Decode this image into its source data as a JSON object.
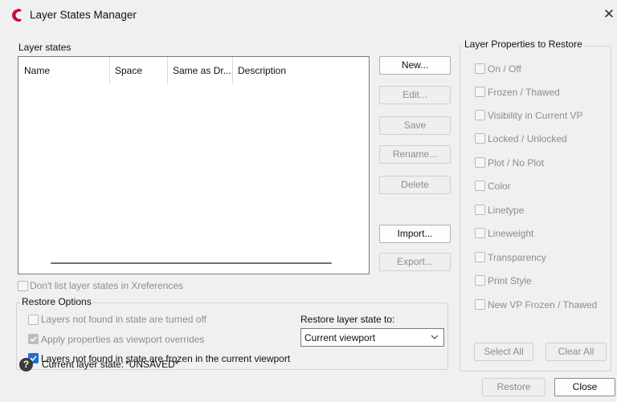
{
  "window": {
    "title": "Layer States Manager",
    "close_glyph": "✕"
  },
  "layer_states": {
    "label": "Layer states",
    "columns": [
      "Name",
      "Space",
      "Same as Dr...",
      "Description"
    ],
    "rows": []
  },
  "buttons": {
    "new": "New...",
    "edit": "Edit...",
    "save": "Save",
    "rename": "Rename...",
    "delete": "Delete",
    "import": "Import...",
    "export": "Export..."
  },
  "dont_list_xrefs": {
    "label": "Don't list layer states in Xreferences",
    "checked": false
  },
  "restore_options": {
    "legend": "Restore Options",
    "opt1": "Layers not found in state are turned off",
    "opt2": "Apply properties as viewport overrides",
    "opt3": "Layers not found in state are frozen in the current viewport",
    "restore_to_label": "Restore layer state to:",
    "restore_to_value": "Current viewport"
  },
  "properties": {
    "legend": "Layer Properties to Restore",
    "items": [
      "On / Off",
      "Frozen / Thawed",
      "Visibility in Current VP",
      "Locked / Unlocked",
      "Plot / No Plot",
      "Color",
      "Linetype",
      "Lineweight",
      "Transparency",
      "Print Style",
      "New VP Frozen / Thawed"
    ],
    "select_all": "Select All",
    "clear_all": "Clear All"
  },
  "footer": {
    "current_label": "Current layer state:",
    "current_value": "*UNSAVED*",
    "restore": "Restore",
    "close": "Close"
  },
  "icons": {
    "app": "autocad-logo-icon",
    "help": "help-icon",
    "dropdown": "chevron-down-icon"
  },
  "colors": {
    "app_logo": "#c8102e",
    "checkbox_checked": "#1e6fd1"
  }
}
